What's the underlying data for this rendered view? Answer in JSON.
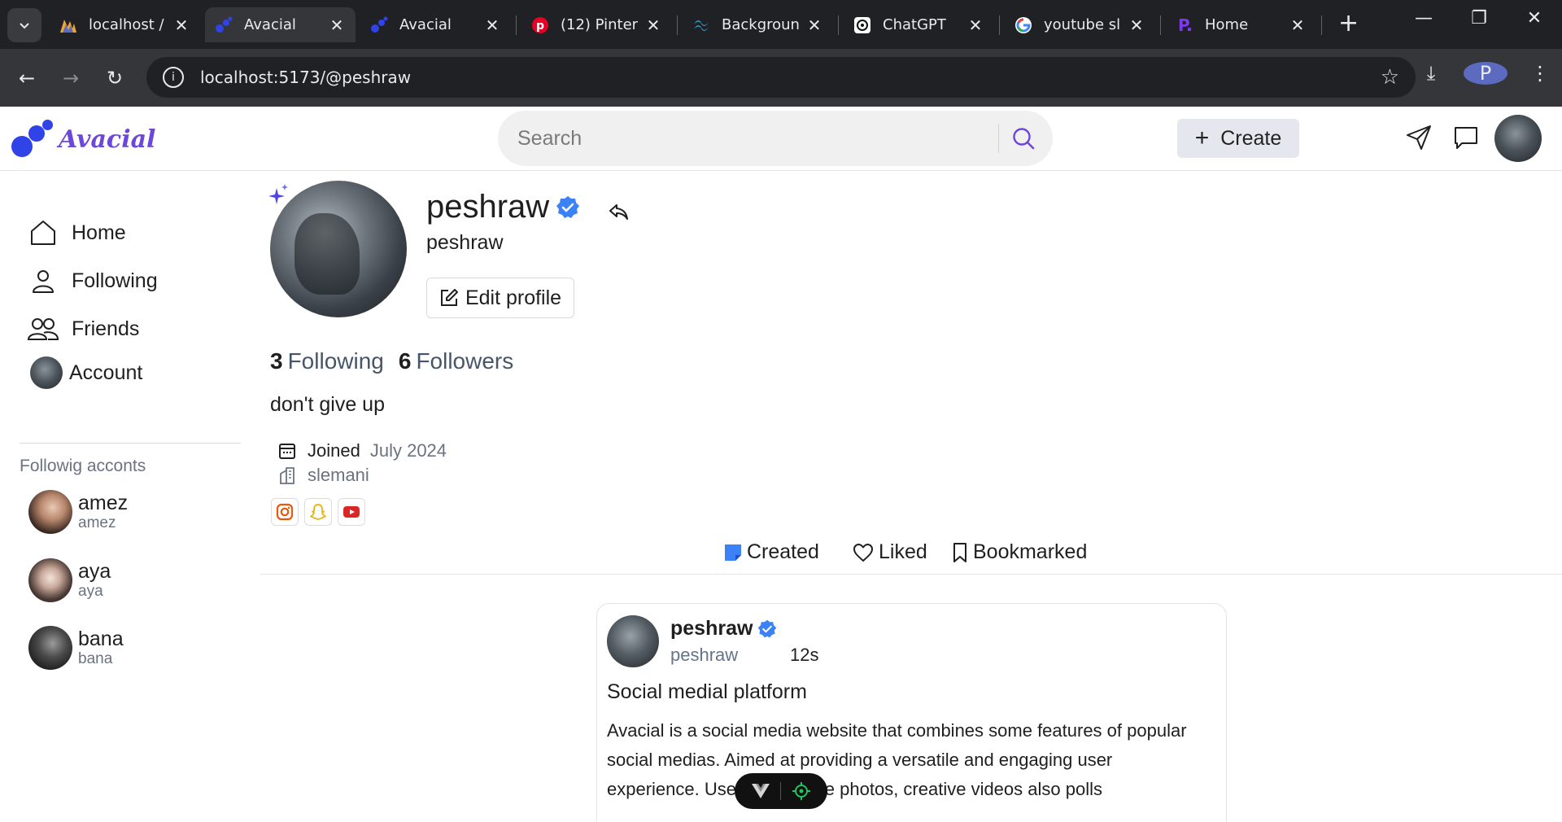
{
  "browser": {
    "tabs": [
      {
        "title": "localhost /",
        "icon": "phpmyadmin-icon",
        "active": false
      },
      {
        "title": "Avacial",
        "icon": "avacial-favicon",
        "active": true
      },
      {
        "title": "Avacial",
        "icon": "avacial-favicon",
        "active": false
      },
      {
        "title": "(12) Pinter",
        "icon": "pinterest-icon",
        "active": false
      },
      {
        "title": "Backgroun",
        "icon": "tailwind-icon",
        "active": false
      },
      {
        "title": "ChatGPT",
        "icon": "chatgpt-icon",
        "active": false
      },
      {
        "title": "youtube sl",
        "icon": "google-icon",
        "active": false
      },
      {
        "title": "Home",
        "icon": "p-icon",
        "active": false
      }
    ],
    "url": "localhost:5173/@peshraw",
    "profile_initial": "P"
  },
  "header": {
    "brand": "Avacial",
    "search_placeholder": "Search",
    "create_label": "Create"
  },
  "sidebar": {
    "nav": [
      {
        "label": "Home",
        "icon": "home-icon"
      },
      {
        "label": "Following",
        "icon": "user-icon"
      },
      {
        "label": "Friends",
        "icon": "users-icon"
      },
      {
        "label": "Account",
        "icon": "avatar"
      }
    ],
    "following_heading": "Followig acconts",
    "following": [
      {
        "name": "amez",
        "handle": "amez"
      },
      {
        "name": "aya",
        "handle": "aya"
      },
      {
        "name": "bana",
        "handle": "bana"
      }
    ]
  },
  "profile": {
    "name": "peshraw",
    "handle": "peshraw",
    "edit_label": "Edit profile",
    "following_count": "3",
    "following_label": "Following",
    "followers_count": "6",
    "followers_label": "Followers",
    "bio": "don't give up",
    "joined_label": "Joined",
    "joined_date": "July 2024",
    "location": "slemani",
    "socials": [
      "instagram-icon",
      "snapchat-icon",
      "youtube-icon"
    ]
  },
  "profile_tabs": [
    {
      "label": "Created",
      "icon": "note-icon"
    },
    {
      "label": "Liked",
      "icon": "heart-icon"
    },
    {
      "label": "Bookmarked",
      "icon": "bookmark-icon"
    }
  ],
  "post": {
    "name": "peshraw",
    "handle": "peshraw",
    "time": "12s",
    "title": "Social medial platform",
    "body": "Avacial is a social media website that combines some features of popular social medias. Aimed at providing a versatile and engaging user experience. Users can share photos, creative videos also polls"
  },
  "colors": {
    "brand": "#6d47d9",
    "logo_blue": "#2f43e6",
    "verify_blue": "#3b82f6"
  }
}
